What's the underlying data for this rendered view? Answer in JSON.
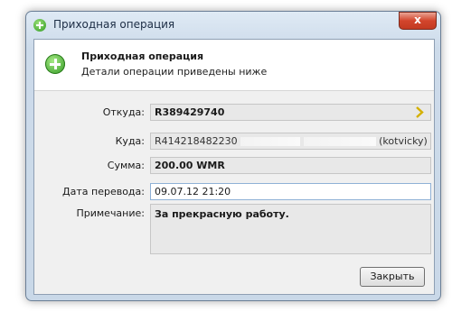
{
  "window": {
    "title": "Приходная операция",
    "close_glyph": "x"
  },
  "header": {
    "title": "Приходная операция",
    "subtitle": "Детали операции приведены ниже"
  },
  "fields": {
    "from_label": "Откуда:",
    "from_value": "R389429740",
    "to_label": "Куда:",
    "to_value_start": "R414218482230",
    "to_value_end": "(kotvicky)",
    "amount_label": "Сумма:",
    "amount_value": "200.00 WMR",
    "date_label": "Дата перевода:",
    "date_value": "09.07.12 21:20",
    "note_label": "Примечание:",
    "note_value": "За прекрасную работу."
  },
  "buttons": {
    "close_label": "Закрыть"
  },
  "icons": {
    "title": "add-circle-icon",
    "header": "add-circle-icon",
    "from_arrow": "chevron-right-icon"
  },
  "colors": {
    "accent_green": "#2f9a21",
    "close_red": "#c33a21",
    "chevron": "#d4b000"
  }
}
